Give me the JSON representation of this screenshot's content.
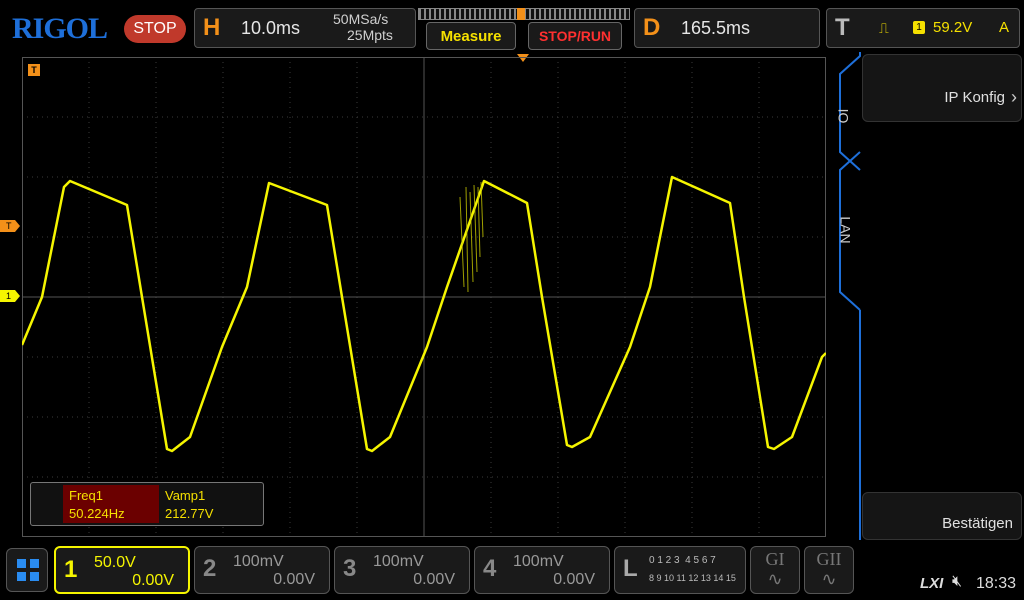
{
  "brand": "RIGOL",
  "run_state": "STOP",
  "horizontal": {
    "letter": "H",
    "timebase": "10.0ms",
    "sample_rate": "50MSa/s",
    "memory_depth": "25Mpts"
  },
  "buttons": {
    "measure": "Measure",
    "stop_run": "STOP/RUN"
  },
  "delay": {
    "letter": "D",
    "value": "165.5ms"
  },
  "trigger": {
    "letter": "T",
    "channel": "1",
    "level": "59.2V",
    "mode": "A"
  },
  "markers": {
    "trigger_level": "T",
    "channel1": "1",
    "trigger_pos": "T"
  },
  "right_menu": {
    "io_tab": "IO",
    "lan_tab": "LAN",
    "ip_config": "IP Konfig",
    "confirm": "Bestätigen"
  },
  "measurements": {
    "headers": [
      "Freq1",
      "Vamp1"
    ],
    "values": [
      "50.224Hz",
      "212.77V"
    ]
  },
  "channels": [
    {
      "num": "1",
      "scale": "50.0V",
      "offset": "0.00V",
      "active": true
    },
    {
      "num": "2",
      "scale": "100mV",
      "offset": "0.00V",
      "active": false
    },
    {
      "num": "3",
      "scale": "100mV",
      "offset": "0.00V",
      "active": false
    },
    {
      "num": "4",
      "scale": "100mV",
      "offset": "0.00V",
      "active": false
    }
  ],
  "logic": {
    "letter": "L",
    "row1": "0 1 2 3  4 5 6 7",
    "row2": "8 9 10 11 12 13 14 15"
  },
  "generators": {
    "g1": "GI",
    "g2": "GII"
  },
  "status": {
    "lxi": "LXI",
    "time": "18:33"
  },
  "colors": {
    "ch1": "#f5f500",
    "accent_orange": "#f39019",
    "stop_red": "#c0392b",
    "panel_blue": "#1e6fd9"
  }
}
